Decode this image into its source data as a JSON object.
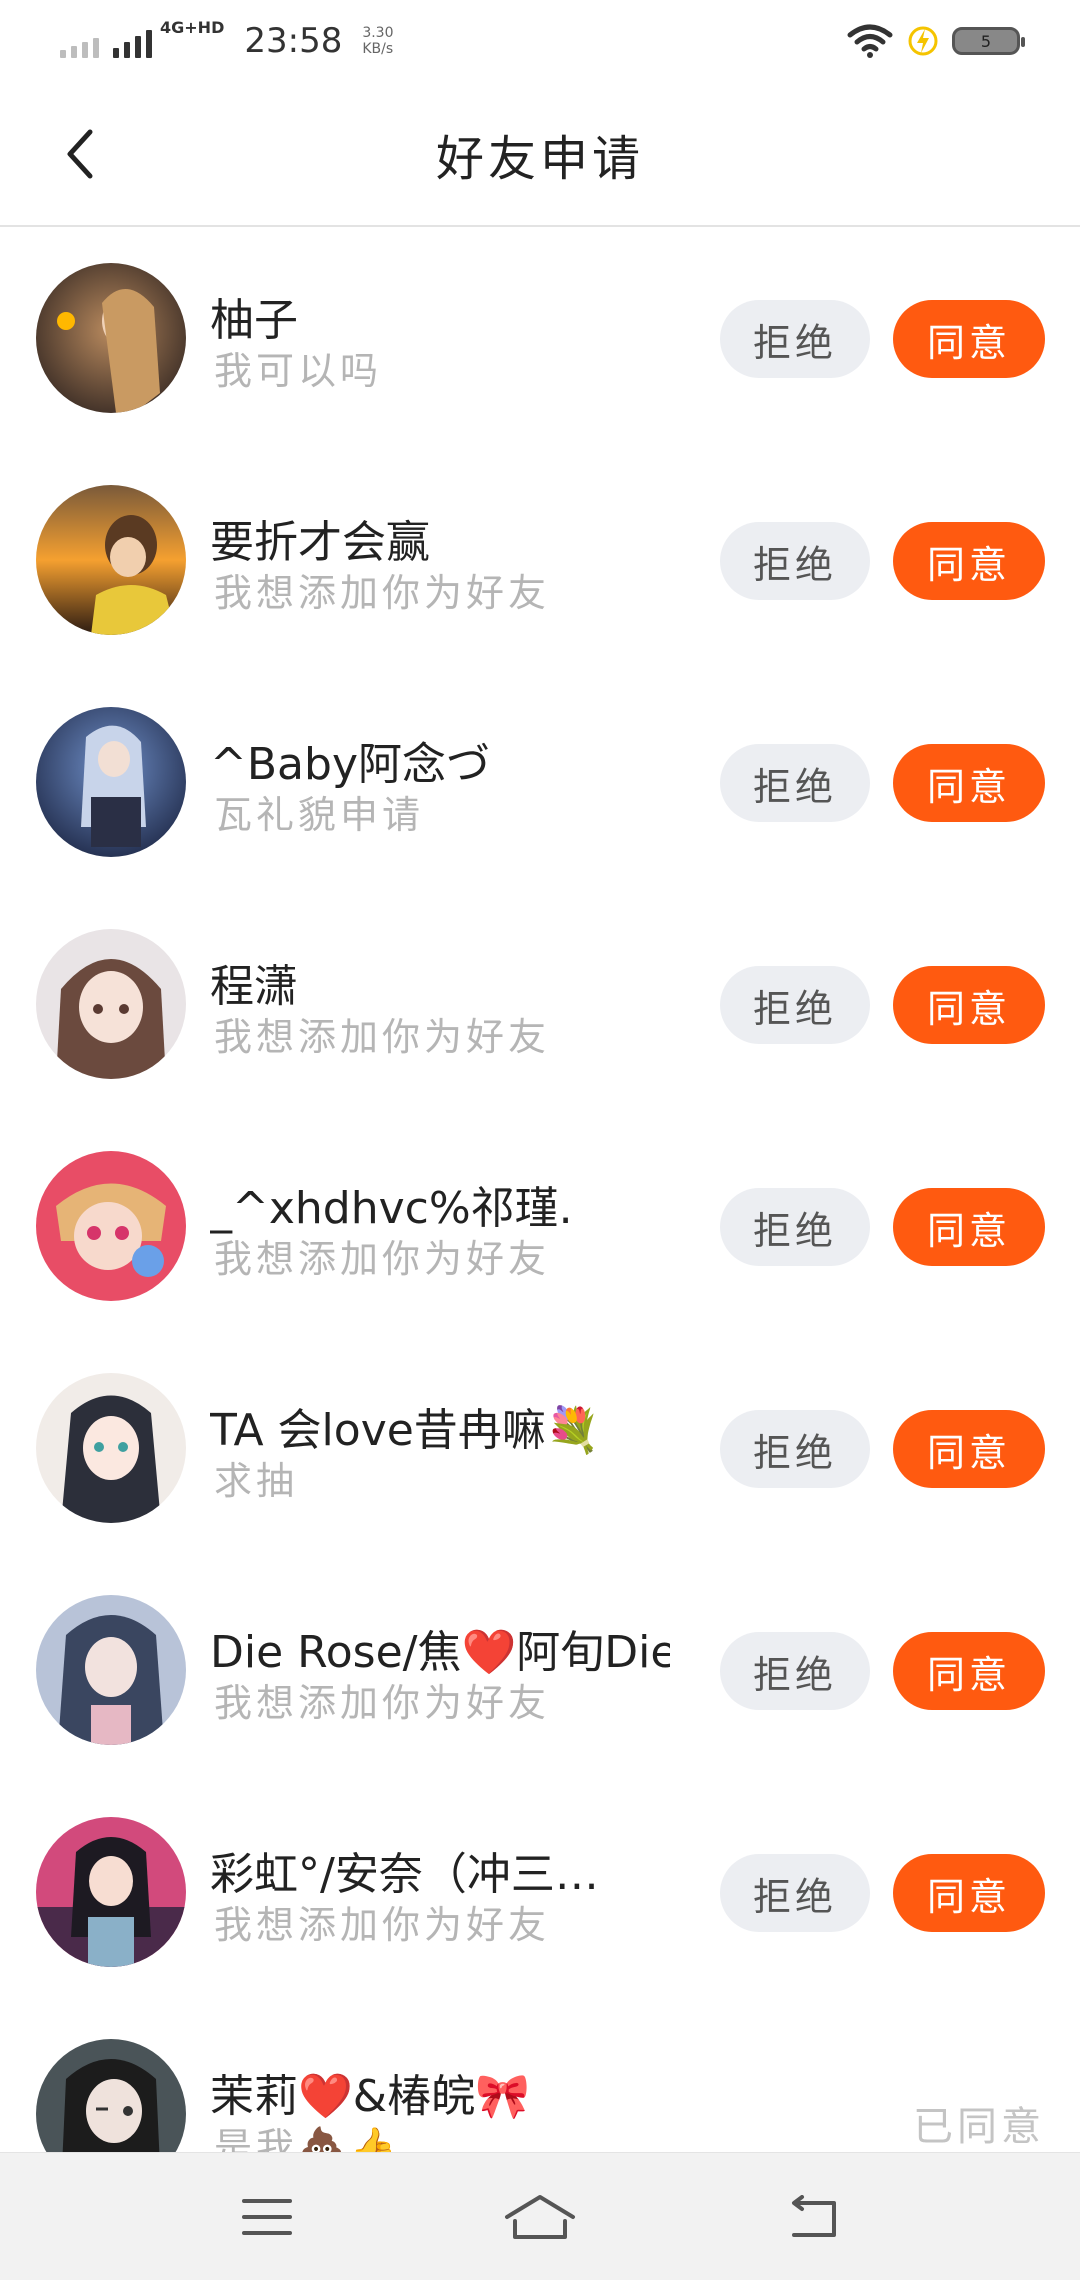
{
  "status_bar": {
    "network": "4G+HD",
    "time": "23:58",
    "speed_value": "3.30",
    "speed_unit": "KB/s",
    "battery": "5"
  },
  "header": {
    "title": "好友申请",
    "back_icon": "back-arrow-icon"
  },
  "accent_color": "#ff5a10",
  "requests": [
    {
      "name": "柚子",
      "message": "我可以吗",
      "status": "pending",
      "reject_label": "拒绝",
      "accept_label": "同意"
    },
    {
      "name": "要折才会赢",
      "message": "我想添加你为好友",
      "status": "pending",
      "reject_label": "拒绝",
      "accept_label": "同意"
    },
    {
      "name": "^Baby阿念づ",
      "message": "瓦礼貌申请",
      "status": "pending",
      "reject_label": "拒绝",
      "accept_label": "同意"
    },
    {
      "name": "程潇",
      "message": "我想添加你为好友",
      "status": "pending",
      "reject_label": "拒绝",
      "accept_label": "同意"
    },
    {
      "name": "_^xhdhvc%祁瑾.",
      "message": "我想添加你为好友",
      "status": "pending",
      "reject_label": "拒绝",
      "accept_label": "同意"
    },
    {
      "name": "TA 会love昔冉嘛💐",
      "message": "求抽",
      "status": "pending",
      "reject_label": "拒绝",
      "accept_label": "同意"
    },
    {
      "name": "Die Rose/焦❤️阿旬Die",
      "message": "我想添加你为好友",
      "status": "pending",
      "reject_label": "拒绝",
      "accept_label": "同意"
    },
    {
      "name": "彩虹°/安奈（冲三…",
      "message": "我想添加你为好友",
      "status": "pending",
      "reject_label": "拒绝",
      "accept_label": "同意"
    },
    {
      "name": "茉莉❤️&椿皖🎀",
      "message": "是我💩👍",
      "status": "accepted",
      "accepted_label": "已同意"
    }
  ],
  "bottom_nav": {
    "menu_icon": "menu-icon",
    "home_icon": "home-icon",
    "back_icon": "back-nav-icon"
  }
}
